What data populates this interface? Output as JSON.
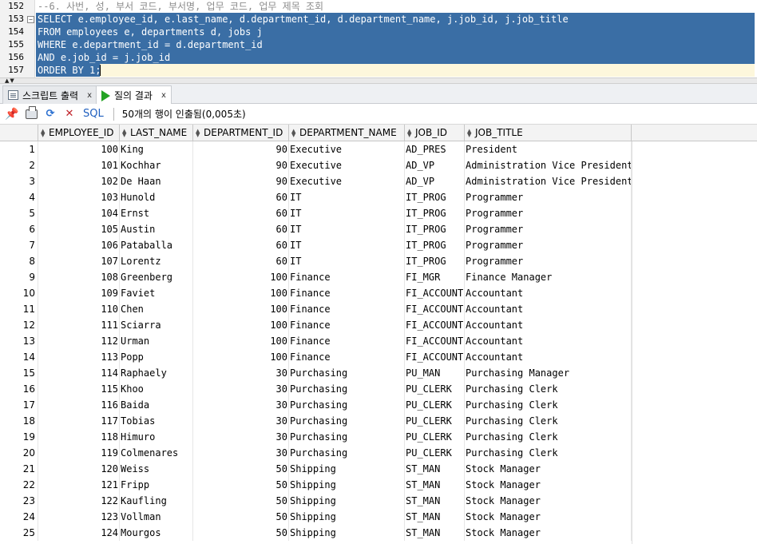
{
  "editor": {
    "lines": [
      {
        "num": "152",
        "text": "--6. 사번, 성, 부서 코드, 부서명, 업무 코드, 업무 제목 조회",
        "kind": "comment"
      },
      {
        "num": "153",
        "text": "SELECT e.employee_id, e.last_name, d.department_id, d.department_name, j.job_id, j.job_title",
        "kind": "selected",
        "fold": "⊟"
      },
      {
        "num": "154",
        "text": "FROM employees e, departments d, jobs j",
        "kind": "selected"
      },
      {
        "num": "155",
        "text": "WHERE e.department_id = d.department_id",
        "kind": "selected"
      },
      {
        "num": "156",
        "text": "AND e.job_id = j.job_id",
        "kind": "selected"
      },
      {
        "num": "157",
        "text": "ORDER BY 1;",
        "kind": "selected-current"
      }
    ]
  },
  "tabs": [
    {
      "label": "스크립트 출력",
      "close": "x",
      "icon": "script-output-icon",
      "active": false
    },
    {
      "label": "질의 결과",
      "close": "x",
      "icon": "run-query-icon",
      "active": true
    }
  ],
  "toolbar": {
    "sql_label": "SQL",
    "status": "50개의 행이 인출됨(0,005초)"
  },
  "grid": {
    "columns": [
      "EMPLOYEE_ID",
      "LAST_NAME",
      "DEPARTMENT_ID",
      "DEPARTMENT_NAME",
      "JOB_ID",
      "JOB_TITLE"
    ],
    "rows": [
      [
        "1",
        "100",
        "King",
        "90",
        "Executive",
        "AD_PRES",
        "President"
      ],
      [
        "2",
        "101",
        "Kochhar",
        "90",
        "Executive",
        "AD_VP",
        "Administration Vice President"
      ],
      [
        "3",
        "102",
        "De Haan",
        "90",
        "Executive",
        "AD_VP",
        "Administration Vice President"
      ],
      [
        "4",
        "103",
        "Hunold",
        "60",
        "IT",
        "IT_PROG",
        "Programmer"
      ],
      [
        "5",
        "104",
        "Ernst",
        "60",
        "IT",
        "IT_PROG",
        "Programmer"
      ],
      [
        "6",
        "105",
        "Austin",
        "60",
        "IT",
        "IT_PROG",
        "Programmer"
      ],
      [
        "7",
        "106",
        "Pataballa",
        "60",
        "IT",
        "IT_PROG",
        "Programmer"
      ],
      [
        "8",
        "107",
        "Lorentz",
        "60",
        "IT",
        "IT_PROG",
        "Programmer"
      ],
      [
        "9",
        "108",
        "Greenberg",
        "100",
        "Finance",
        "FI_MGR",
        "Finance Manager"
      ],
      [
        "10",
        "109",
        "Faviet",
        "100",
        "Finance",
        "FI_ACCOUNT",
        "Accountant"
      ],
      [
        "11",
        "110",
        "Chen",
        "100",
        "Finance",
        "FI_ACCOUNT",
        "Accountant"
      ],
      [
        "12",
        "111",
        "Sciarra",
        "100",
        "Finance",
        "FI_ACCOUNT",
        "Accountant"
      ],
      [
        "13",
        "112",
        "Urman",
        "100",
        "Finance",
        "FI_ACCOUNT",
        "Accountant"
      ],
      [
        "14",
        "113",
        "Popp",
        "100",
        "Finance",
        "FI_ACCOUNT",
        "Accountant"
      ],
      [
        "15",
        "114",
        "Raphaely",
        "30",
        "Purchasing",
        "PU_MAN",
        "Purchasing Manager"
      ],
      [
        "16",
        "115",
        "Khoo",
        "30",
        "Purchasing",
        "PU_CLERK",
        "Purchasing Clerk"
      ],
      [
        "17",
        "116",
        "Baida",
        "30",
        "Purchasing",
        "PU_CLERK",
        "Purchasing Clerk"
      ],
      [
        "18",
        "117",
        "Tobias",
        "30",
        "Purchasing",
        "PU_CLERK",
        "Purchasing Clerk"
      ],
      [
        "19",
        "118",
        "Himuro",
        "30",
        "Purchasing",
        "PU_CLERK",
        "Purchasing Clerk"
      ],
      [
        "20",
        "119",
        "Colmenares",
        "30",
        "Purchasing",
        "PU_CLERK",
        "Purchasing Clerk"
      ],
      [
        "21",
        "120",
        "Weiss",
        "50",
        "Shipping",
        "ST_MAN",
        "Stock Manager"
      ],
      [
        "22",
        "121",
        "Fripp",
        "50",
        "Shipping",
        "ST_MAN",
        "Stock Manager"
      ],
      [
        "23",
        "122",
        "Kaufling",
        "50",
        "Shipping",
        "ST_MAN",
        "Stock Manager"
      ],
      [
        "24",
        "123",
        "Vollman",
        "50",
        "Shipping",
        "ST_MAN",
        "Stock Manager"
      ],
      [
        "25",
        "124",
        "Mourgos",
        "50",
        "Shipping",
        "ST_MAN",
        "Stock Manager"
      ]
    ]
  },
  "colors": {
    "selection": "#3a6ea5",
    "current_line": "#fdf7dc",
    "comment": "#8c8c8c"
  }
}
